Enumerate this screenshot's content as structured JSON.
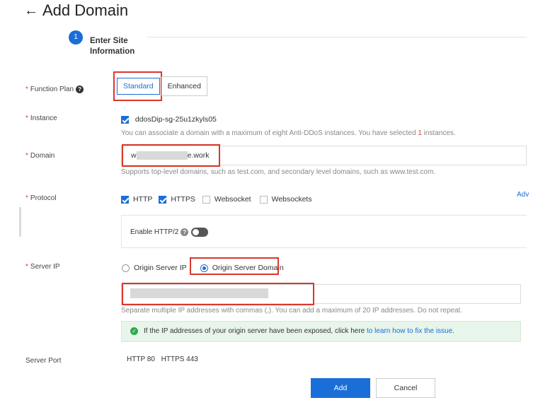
{
  "header": {
    "back_arrow": "←",
    "title": "Add Domain"
  },
  "steps": [
    {
      "number": "1",
      "label": "Enter Site Information"
    }
  ],
  "function_plan": {
    "label": "Function Plan",
    "options": [
      "Standard",
      "Enhanced"
    ],
    "selected": "Standard"
  },
  "instance": {
    "label": "Instance",
    "value": "ddosDip-sg-25u1zkyls05",
    "hint_before": "You can associate a domain with a maximum of eight Anti-DDoS instances. You have selected ",
    "hint_count": "1",
    "hint_after": " instances."
  },
  "domain": {
    "label": "Domain",
    "visible_prefix": "w",
    "visible_suffix": "e.work",
    "hint": "Supports top-level domains, such as test.com, and secondary level domains, such as www.test.com."
  },
  "protocol": {
    "label": "Protocol",
    "options": [
      {
        "label": "HTTP",
        "checked": true
      },
      {
        "label": "HTTPS",
        "checked": true
      },
      {
        "label": "Websocket",
        "checked": false
      },
      {
        "label": "Websockets",
        "checked": false
      }
    ],
    "advanced_link": "Adv",
    "http2_label": "Enable HTTP/2",
    "http2_enabled": false
  },
  "server_ip": {
    "label": "Server IP",
    "options": [
      "Origin Server IP",
      "Origin Server Domain"
    ],
    "selected": "Origin Server Domain",
    "hint": "Separate multiple IP addresses with commas (,). You can add a maximum of 20 IP addresses. Do not repeat.",
    "notice_text": "If the IP addresses of your origin server have been exposed, click here ",
    "notice_link": "to learn how to fix the issue."
  },
  "server_port": {
    "label": "Server Port",
    "http": "HTTP 80",
    "https": "HTTPS 443"
  },
  "footer": {
    "add": "Add",
    "cancel": "Cancel"
  },
  "colors": {
    "accent": "#1a6ed8",
    "required": "#e5412b",
    "highlight_box": "#d9382d",
    "success_bg": "#e7f5ea"
  }
}
